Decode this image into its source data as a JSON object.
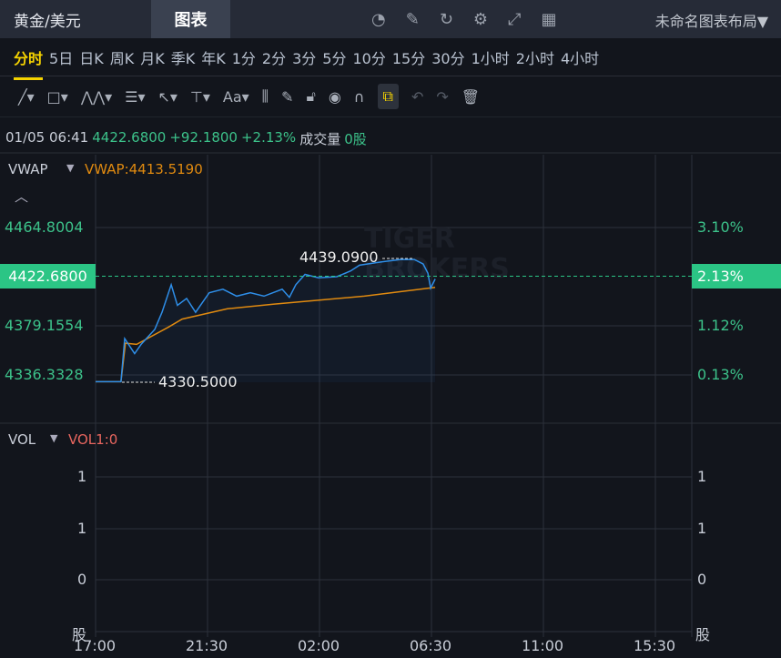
{
  "header": {
    "symbol": "黄金/美元",
    "tab": "图表",
    "layout": "未命名图表布局▼"
  },
  "periods": [
    "分时",
    "5日",
    "日K",
    "周K",
    "月K",
    "季K",
    "年K",
    "1分",
    "2分",
    "3分",
    "5分",
    "10分",
    "15分",
    "30分",
    "1小时",
    "2小时",
    "4小时"
  ],
  "info": {
    "datetime": "01/05 06:41",
    "price": "4422.6800",
    "change": "+92.1800",
    "pct": "+2.13%",
    "vol_label": "成交量",
    "vol": "0股"
  },
  "vwap": {
    "name": "VWAP",
    "value": "VWAP:4413.5190"
  },
  "vol": {
    "name": "VOL",
    "value": "VOL1:0"
  },
  "colors": {
    "up": "#3cc28a",
    "price_line": "#2e8ee8",
    "vwap_line": "#e08a10",
    "accent": "#f5d300"
  },
  "chart_data": {
    "type": "line",
    "y_left_ticks": [
      "4464.8004",
      "4422.6800",
      "4379.1554",
      "4336.3328"
    ],
    "y_right_ticks": [
      "3.10%",
      "2.13%",
      "1.12%",
      "0.13%"
    ],
    "x_ticks": [
      "17:00",
      "21:30",
      "02:00",
      "06:30",
      "11:00",
      "15:30"
    ],
    "high_label": "4439.0900",
    "low_label": "4330.5000",
    "ylim": [
      4336.3328,
      4464.8004
    ],
    "vol_ticks_left": [
      "1",
      "1",
      "0",
      "股"
    ],
    "vol_ticks_right": [
      "1",
      "1",
      "0",
      "股"
    ],
    "price_series": {
      "hours": [
        0,
        1.02,
        1.17,
        1.57,
        1.83,
        2.38,
        2.67,
        3.04,
        3.29,
        3.66,
        4.02,
        4.57,
        5.12,
        5.67,
        6.22,
        6.77,
        7.5,
        7.79,
        8.05,
        8.42,
        8.96,
        9.7,
        10.25,
        10.61,
        11.53,
        12.26,
        12.81,
        13.17,
        13.36,
        13.47,
        13.65
      ],
      "values": [
        4330.5,
        4330.5,
        4368,
        4355,
        4363,
        4376,
        4391,
        4415,
        4397,
        4403,
        4391,
        4408,
        4411,
        4405,
        4408,
        4405,
        4411,
        4404,
        4415,
        4424,
        4421,
        4422,
        4427,
        4432,
        4435,
        4437,
        4437,
        4433,
        4425,
        4412,
        4420
      ]
    },
    "vwap_series": {
      "hours": [
        0,
        1.02,
        1.2,
        1.65,
        2.93,
        3.48,
        5.3,
        7.14,
        10.8,
        13.65
      ],
      "values": [
        4330.5,
        4330.5,
        4364,
        4363,
        4378,
        4385,
        4394,
        4398,
        4405,
        4412.7
      ]
    }
  }
}
